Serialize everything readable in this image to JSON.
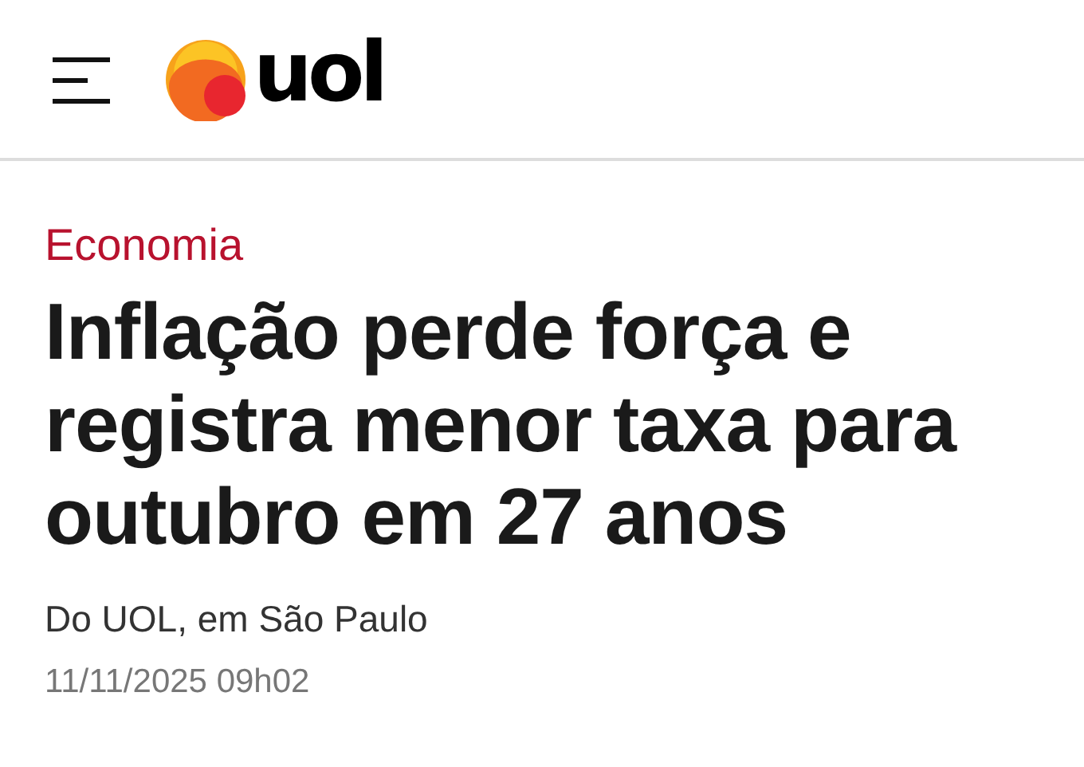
{
  "header": {
    "logo_text": "uol"
  },
  "article": {
    "category": "Economia",
    "headline": "Inflação perde força e registra menor taxa para outubro em 27 anos",
    "byline": "Do UOL, em São Paulo",
    "date": "11/11/2025 09h02"
  }
}
